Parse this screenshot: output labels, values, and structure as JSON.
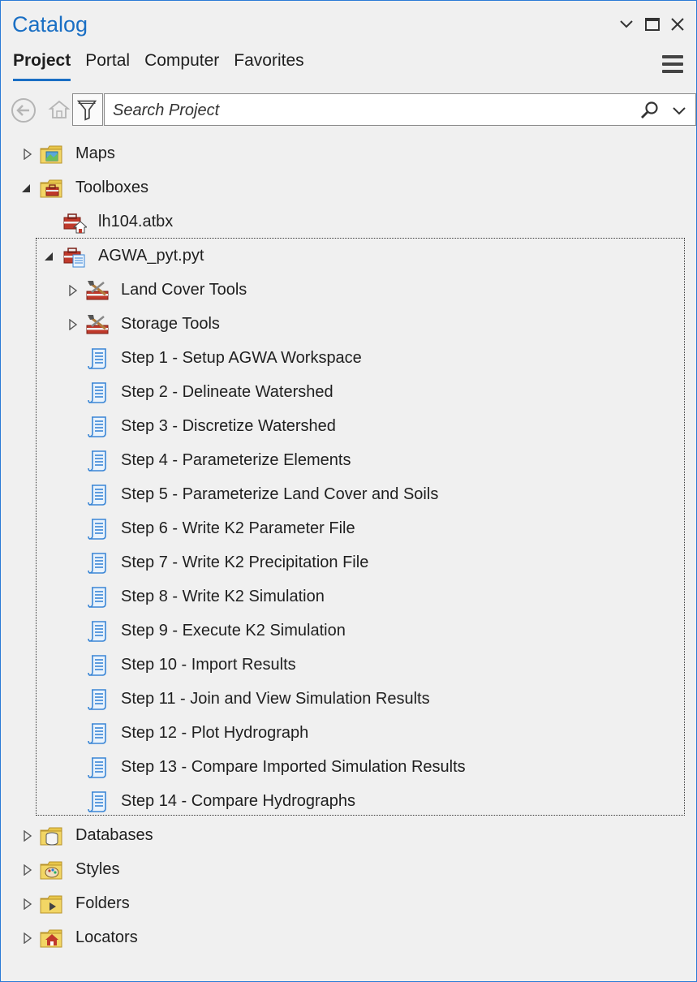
{
  "window": {
    "title": "Catalog"
  },
  "tabs": [
    {
      "label": "Project",
      "active": true
    },
    {
      "label": "Portal",
      "active": false
    },
    {
      "label": "Computer",
      "active": false
    },
    {
      "label": "Favorites",
      "active": false
    }
  ],
  "search": {
    "placeholder": "Search Project",
    "value": ""
  },
  "tree": {
    "maps": "Maps",
    "toolboxes": "Toolboxes",
    "atbx": "lh104.atbx",
    "pyt": "AGWA_pyt.pyt",
    "land_cover_tools": "Land Cover Tools",
    "storage_tools": "Storage Tools",
    "steps": [
      "Step 1 - Setup AGWA Workspace",
      "Step 2 - Delineate Watershed",
      "Step 3 - Discretize Watershed",
      "Step 4 - Parameterize Elements",
      "Step 5 - Parameterize Land Cover and Soils",
      "Step 6 - Write K2 Parameter File",
      "Step 7 - Write K2 Precipitation File",
      "Step 8 - Write K2 Simulation",
      "Step 9 - Execute K2 Simulation",
      "Step 10 - Import Results",
      "Step 11 - Join and View Simulation Results",
      "Step 12 - Plot Hydrograph",
      "Step 13 - Compare Imported Simulation Results",
      "Step 14 - Compare Hydrographs"
    ],
    "databases": "Databases",
    "styles": "Styles",
    "folders": "Folders",
    "locators": "Locators"
  },
  "colors": {
    "accent": "#1a6fc4",
    "folder": "#e8c64a",
    "toolbox": "#c0392b",
    "script": "#3a86d6"
  }
}
